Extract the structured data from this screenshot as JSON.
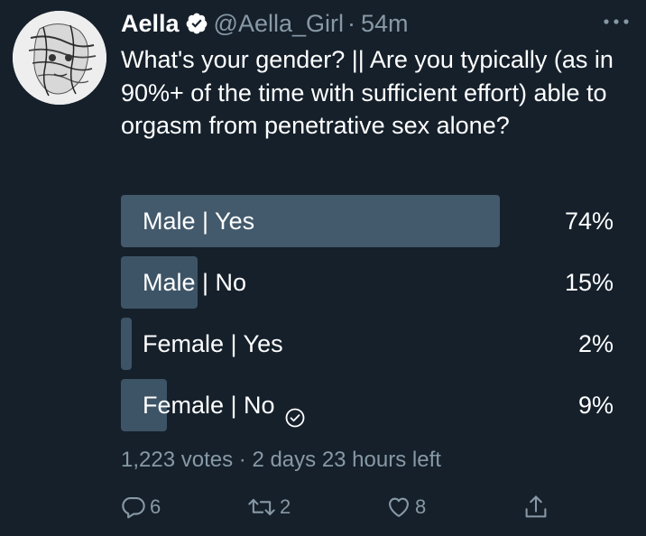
{
  "tweet": {
    "author_name": "Aella",
    "handle": "@Aella_Girl",
    "separator": "·",
    "time": "54m",
    "text": "What's your gender? || Are you typically (as in 90%+ of the time with sufficient effort) able to orgasm from penetrative sex alone?"
  },
  "poll": {
    "options": [
      {
        "label": "Male | Yes",
        "percent": "74%",
        "share": 74,
        "leading": true,
        "voted": false
      },
      {
        "label": "Male | No",
        "percent": "15%",
        "share": 15,
        "leading": false,
        "voted": false
      },
      {
        "label": "Female | Yes",
        "percent": "2%",
        "share": 2,
        "leading": false,
        "voted": false
      },
      {
        "label": "Female | No",
        "percent": "9%",
        "share": 9,
        "leading": false,
        "voted": true
      }
    ],
    "votes": "1,223 votes",
    "separator": "·",
    "time_left": "2 days 23 hours left"
  },
  "actions": {
    "reply_count": "6",
    "retweet_count": "2",
    "like_count": "8"
  },
  "colors": {
    "background": "#15202b",
    "bar": "#3d5466",
    "bar_leading": "#435a6c",
    "muted_text": "#8899a6"
  },
  "icons": {
    "verified": "verified-badge-icon",
    "more": "more-dots-icon",
    "voted": "check-circle-icon",
    "reply": "reply-icon",
    "retweet": "retweet-icon",
    "like": "heart-icon",
    "share": "share-icon"
  }
}
